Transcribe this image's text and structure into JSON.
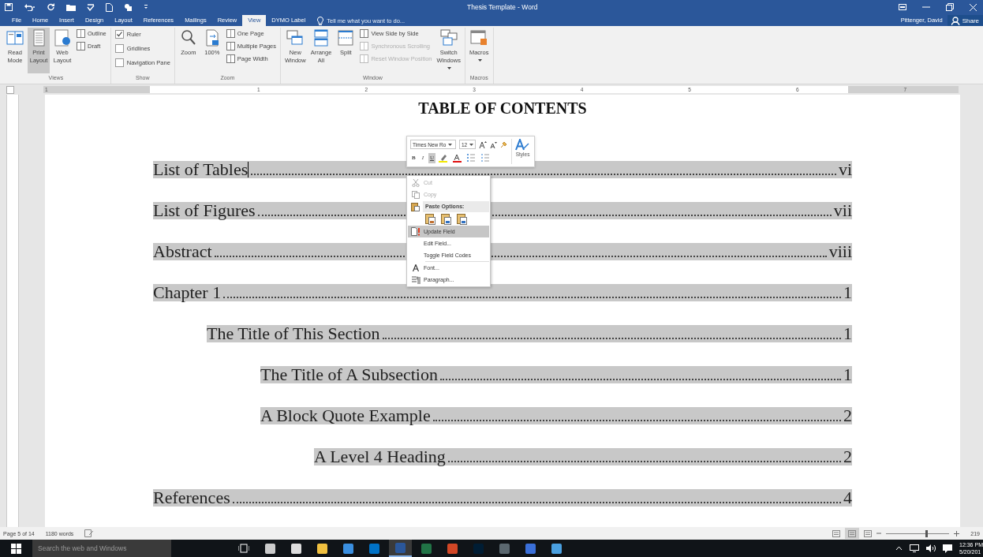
{
  "window": {
    "title": "Thesis Template - Word",
    "user": "Pittenger, David",
    "share": "Share"
  },
  "tabs": [
    {
      "label": "File",
      "selected": false
    },
    {
      "label": "Home",
      "selected": false
    },
    {
      "label": "Insert",
      "selected": false
    },
    {
      "label": "Design",
      "selected": false
    },
    {
      "label": "Layout",
      "selected": false
    },
    {
      "label": "References",
      "selected": false
    },
    {
      "label": "Mailings",
      "selected": false
    },
    {
      "label": "Review",
      "selected": false
    },
    {
      "label": "View",
      "selected": true
    },
    {
      "label": "DYMO Label",
      "selected": false
    }
  ],
  "tell_me": {
    "placeholder": "Tell me what you want to do..."
  },
  "ribbon": {
    "groups": [
      {
        "label": "Views",
        "columns": [
          [
            {
              "kind": "large",
              "label": "Read Mode",
              "selected": false
            }
          ],
          [
            {
              "kind": "large",
              "label": "Print Layout",
              "selected": true
            }
          ],
          [
            {
              "kind": "large",
              "label": "Web Layout",
              "selected": false
            }
          ],
          [
            {
              "kind": "small",
              "label": "Outline"
            },
            {
              "kind": "small",
              "label": "Draft"
            }
          ]
        ]
      },
      {
        "label": "Show",
        "columns": [
          [
            {
              "kind": "check",
              "label": "Ruler",
              "checked": true
            },
            {
              "kind": "check",
              "label": "Gridlines",
              "checked": false
            },
            {
              "kind": "check",
              "label": "Navigation Pane",
              "checked": false
            }
          ]
        ]
      },
      {
        "label": "Zoom",
        "columns": [
          [
            {
              "kind": "large",
              "label": "Zoom",
              "selected": false
            }
          ],
          [
            {
              "kind": "large",
              "label": "100%",
              "selected": false
            }
          ],
          [
            {
              "kind": "small",
              "label": "One Page"
            },
            {
              "kind": "small",
              "label": "Multiple Pages"
            },
            {
              "kind": "small",
              "label": "Page Width"
            }
          ]
        ]
      },
      {
        "label": "Window",
        "columns": [
          [
            {
              "kind": "large",
              "label": "New Window",
              "selected": false
            }
          ],
          [
            {
              "kind": "large",
              "label": "Arrange All",
              "selected": false
            }
          ],
          [
            {
              "kind": "large",
              "label": "Split",
              "selected": false
            }
          ],
          [
            {
              "kind": "small",
              "label": "View Side by Side",
              "disabled": false
            },
            {
              "kind": "small",
              "label": "Synchronous Scrolling",
              "disabled": true
            },
            {
              "kind": "small",
              "label": "Reset Window Position",
              "disabled": true
            }
          ],
          [
            {
              "kind": "large",
              "label": "Switch Windows",
              "selected": false,
              "dropdown": true
            }
          ]
        ]
      },
      {
        "label": "Macros",
        "columns": [
          [
            {
              "kind": "large",
              "label": "Macros",
              "selected": false,
              "dropdown": true
            }
          ]
        ]
      }
    ]
  },
  "ruler": {
    "labels": [
      "1",
      "1",
      "2",
      "3",
      "4",
      "5",
      "6",
      "7"
    ]
  },
  "document": {
    "title": "TABLE OF CONTENTS",
    "toc": [
      {
        "label": "List of Tables",
        "page": "vi",
        "cursor": true
      },
      {
        "label": "List of Figures",
        "page": "vii"
      },
      {
        "label": "Abstract",
        "page": "viii"
      },
      {
        "label": "Chapter 1",
        "page": "1",
        "children": [
          {
            "label": "The Title of This Section",
            "page": "1",
            "children": [
              {
                "label": "The Title of A Subsection",
                "page": "1"
              },
              {
                "label": "A Block Quote Example",
                "page": "2",
                "children": [
                  {
                    "label": "A Level 4 Heading",
                    "page": "2"
                  }
                ]
              }
            ]
          }
        ]
      },
      {
        "label": "References",
        "page": "4"
      }
    ]
  },
  "mini_toolbar": {
    "font": "Times New Ro",
    "size": "12",
    "bold": "B",
    "italic": "I",
    "underline": "U",
    "underline_on": true,
    "styles": "Styles"
  },
  "context_menu": [
    {
      "kind": "item",
      "label": "Cut",
      "disabled": true,
      "selected": false
    },
    {
      "kind": "item",
      "label": "Copy",
      "disabled": true,
      "selected": false
    },
    {
      "kind": "header",
      "label": "Paste Options:"
    },
    {
      "kind": "paste"
    },
    {
      "kind": "item",
      "label": "Update Field",
      "disabled": false,
      "selected": true
    },
    {
      "kind": "item",
      "label": "Edit Field...",
      "disabled": false,
      "selected": false
    },
    {
      "kind": "item",
      "label": "Toggle Field Codes",
      "disabled": false,
      "selected": false
    },
    {
      "kind": "separator"
    },
    {
      "kind": "item",
      "label": "Font...",
      "disabled": false,
      "selected": false
    },
    {
      "kind": "item",
      "label": "Paragraph...",
      "disabled": false,
      "selected": false
    }
  ],
  "status_bar": {
    "page": "Page 5 of 14",
    "words": "1180 words",
    "views": [
      {
        "selected": false
      },
      {
        "selected": true
      },
      {
        "selected": false
      }
    ],
    "zoom": {
      "level": 0.62,
      "reading": "219"
    }
  },
  "taskbar": {
    "search": {
      "placeholder": "Search the web and Windows"
    },
    "apps": [
      {
        "selected": false
      },
      {
        "selected": false
      },
      {
        "selected": false
      },
      {
        "selected": false
      },
      {
        "selected": false
      },
      {
        "selected": true
      },
      {
        "selected": false
      },
      {
        "selected": false
      },
      {
        "selected": false
      },
      {
        "selected": false
      },
      {
        "selected": false
      },
      {
        "selected": false
      }
    ],
    "time": "12:36 PM",
    "date": "5/20/201"
  }
}
